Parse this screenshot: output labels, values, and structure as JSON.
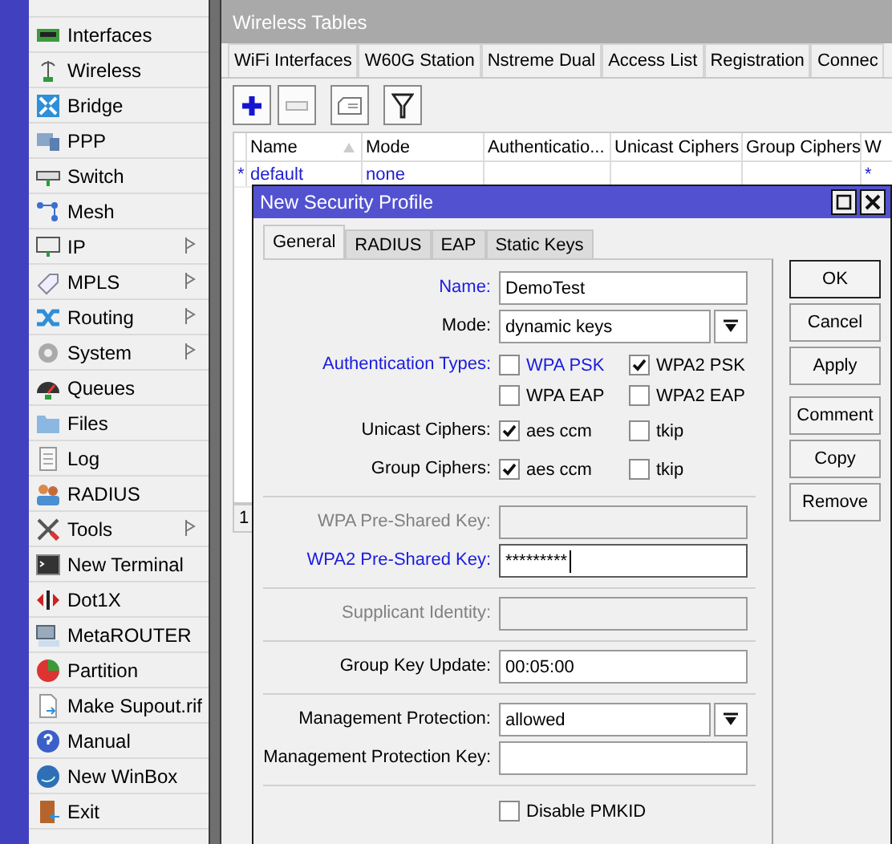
{
  "menu": {
    "items": [
      {
        "label": "Interfaces",
        "has_submenu": false
      },
      {
        "label": "Wireless",
        "has_submenu": false
      },
      {
        "label": "Bridge",
        "has_submenu": false
      },
      {
        "label": "PPP",
        "has_submenu": false
      },
      {
        "label": "Switch",
        "has_submenu": false
      },
      {
        "label": "Mesh",
        "has_submenu": false
      },
      {
        "label": "IP",
        "has_submenu": true
      },
      {
        "label": "MPLS",
        "has_submenu": true
      },
      {
        "label": "Routing",
        "has_submenu": true
      },
      {
        "label": "System",
        "has_submenu": true
      },
      {
        "label": "Queues",
        "has_submenu": false
      },
      {
        "label": "Files",
        "has_submenu": false
      },
      {
        "label": "Log",
        "has_submenu": false
      },
      {
        "label": "RADIUS",
        "has_submenu": false
      },
      {
        "label": "Tools",
        "has_submenu": true
      },
      {
        "label": "New Terminal",
        "has_submenu": false
      },
      {
        "label": "Dot1X",
        "has_submenu": false
      },
      {
        "label": "MetaROUTER",
        "has_submenu": false
      },
      {
        "label": "Partition",
        "has_submenu": false
      },
      {
        "label": "Make Supout.rif",
        "has_submenu": false
      },
      {
        "label": "Manual",
        "has_submenu": false
      },
      {
        "label": "New WinBox",
        "has_submenu": false
      },
      {
        "label": "Exit",
        "has_submenu": false
      }
    ]
  },
  "main_window": {
    "title": "Wireless Tables",
    "tabs": [
      {
        "label": "WiFi Interfaces",
        "selected": false
      },
      {
        "label": "W60G Station",
        "selected": false
      },
      {
        "label": "Nstreme Dual",
        "selected": false
      },
      {
        "label": "Access List",
        "selected": false
      },
      {
        "label": "Registration",
        "selected": false
      },
      {
        "label": "Connec",
        "selected": false
      }
    ],
    "toolbar": [
      {
        "kind": "add",
        "disabled": false
      },
      {
        "kind": "remove",
        "disabled": true
      },
      {
        "kind": "comment",
        "disabled": false
      },
      {
        "kind": "filter",
        "disabled": false
      }
    ],
    "table": {
      "columns": [
        {
          "label": "Name",
          "sorted": true
        },
        {
          "label": "Mode"
        },
        {
          "label": "Authenticatio..."
        },
        {
          "label": "Unicast Ciphers"
        },
        {
          "label": "Group Ciphers"
        },
        {
          "label": "W"
        }
      ],
      "rows": [
        {
          "marker": "*",
          "cells": [
            "default",
            "none",
            null,
            null,
            null,
            "*"
          ]
        }
      ]
    },
    "status": "1"
  },
  "dialog": {
    "title": "New Security Profile",
    "tabs": [
      {
        "label": "General",
        "selected": true
      },
      {
        "label": "RADIUS",
        "selected": false
      },
      {
        "label": "EAP",
        "selected": false
      },
      {
        "label": "Static Keys",
        "selected": false
      }
    ],
    "buttons": [
      "OK",
      "Cancel",
      "Apply",
      "Comment",
      "Copy",
      "Remove"
    ],
    "form": [
      {
        "kind": "text",
        "label": "Name:",
        "value": "DemoTest",
        "highlighted": true,
        "disabled": false,
        "focused": false
      },
      {
        "kind": "select",
        "label": "Mode:",
        "value": "dynamic keys",
        "highlighted": false,
        "disabled": false
      },
      {
        "kind": "checkgroup",
        "label": "Authentication Types:",
        "highlighted": true,
        "options": [
          {
            "label": "WPA PSK",
            "checked": false,
            "highlighted": true
          },
          {
            "label": "WPA2 PSK",
            "checked": true,
            "highlighted": false
          },
          {
            "label": "WPA EAP",
            "checked": false,
            "highlighted": false
          },
          {
            "label": "WPA2 EAP",
            "checked": false,
            "highlighted": false
          }
        ]
      },
      {
        "kind": "checkgroup",
        "label": "Unicast Ciphers:",
        "highlighted": false,
        "options": [
          {
            "label": "aes ccm",
            "checked": true,
            "highlighted": false
          },
          {
            "label": "tkip",
            "checked": false,
            "highlighted": false
          }
        ]
      },
      {
        "kind": "checkgroup",
        "label": "Group Ciphers:",
        "highlighted": false,
        "options": [
          {
            "label": "aes ccm",
            "checked": true,
            "highlighted": false
          },
          {
            "label": "tkip",
            "checked": false,
            "highlighted": false
          }
        ]
      },
      {
        "kind": "separator"
      },
      {
        "kind": "text",
        "label": "WPA Pre-Shared Key:",
        "disabled": true,
        "focused": false
      },
      {
        "kind": "text",
        "label": "WPA2 Pre-Shared Key:",
        "value": "*********",
        "highlighted": true,
        "disabled": false,
        "focused": true
      },
      {
        "kind": "separator"
      },
      {
        "kind": "text",
        "label": "Supplicant Identity:",
        "disabled": true,
        "focused": false
      },
      {
        "kind": "separator"
      },
      {
        "kind": "text",
        "label": "Group Key Update:",
        "value": "00:05:00",
        "highlighted": false,
        "disabled": false,
        "focused": false
      },
      {
        "kind": "separator"
      },
      {
        "kind": "select",
        "label": "Management Protection:",
        "value": "allowed",
        "highlighted": false,
        "disabled": false
      },
      {
        "kind": "text",
        "label": "Management Protection Key:",
        "highlighted": false,
        "disabled": false,
        "focused": false
      },
      {
        "kind": "separator"
      },
      {
        "kind": "checkbox",
        "label": "Disable PMKID",
        "checked": false
      }
    ]
  }
}
